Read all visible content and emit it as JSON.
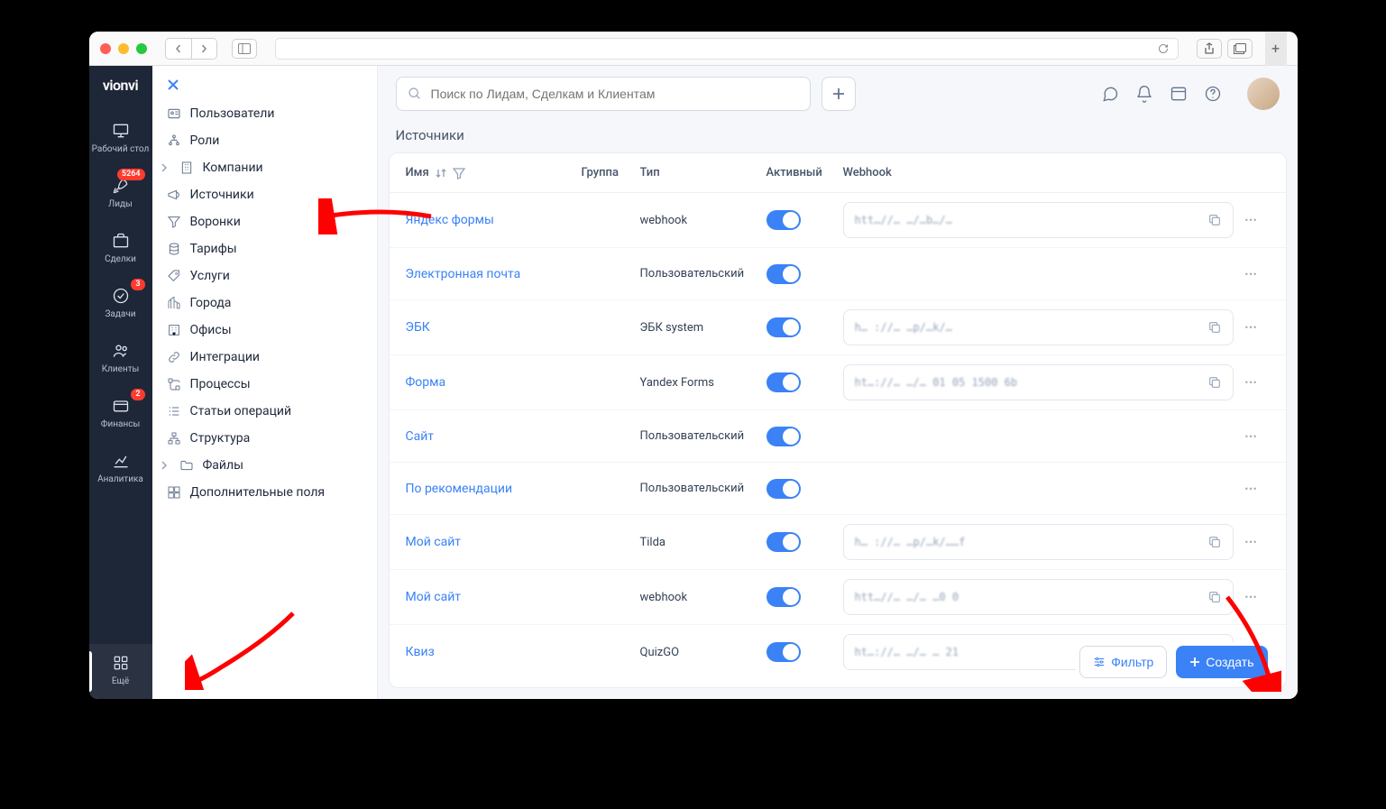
{
  "brand": "vionvi",
  "rail": [
    {
      "label": "Рабочий стол"
    },
    {
      "label": "Лиды",
      "badge": "5264"
    },
    {
      "label": "Сделки"
    },
    {
      "label": "Задачи",
      "badge": "3"
    },
    {
      "label": "Клиенты"
    },
    {
      "label": "Финансы",
      "badge": "2"
    },
    {
      "label": "Аналитика"
    },
    {
      "label": "Ещё"
    }
  ],
  "sidepanel": [
    {
      "label": "Пользователи"
    },
    {
      "label": "Роли"
    },
    {
      "label": "Компании",
      "chevron": true
    },
    {
      "label": "Источники"
    },
    {
      "label": "Воронки"
    },
    {
      "label": "Тарифы"
    },
    {
      "label": "Услуги"
    },
    {
      "label": "Города"
    },
    {
      "label": "Офисы"
    },
    {
      "label": "Интеграции"
    },
    {
      "label": "Процессы"
    },
    {
      "label": "Статьи операций"
    },
    {
      "label": "Структура"
    },
    {
      "label": "Файлы",
      "chevron": true
    },
    {
      "label": "Дополнительные поля"
    }
  ],
  "search_placeholder": "Поиск по Лидам, Сделкам и Клиентам",
  "page_title": "Источники",
  "columns": {
    "name": "Имя",
    "group": "Группа",
    "type": "Тип",
    "active": "Активный",
    "webhook": "Webhook"
  },
  "rows": [
    {
      "name": "Яндекс формы",
      "type": "webhook",
      "active": true,
      "webhook": "htt…//…      …/…b…/…"
    },
    {
      "name": "Электронная почта",
      "type": "Пользовательский",
      "active": true,
      "webhook": ""
    },
    {
      "name": "ЭБК",
      "type": "ЭБК system",
      "active": true,
      "webhook": "h…  ://… …p/…k/…"
    },
    {
      "name": "Форма",
      "type": "Yandex Forms",
      "active": true,
      "webhook": "ht…://… …/… 01 05 1500 6b"
    },
    {
      "name": "Сайт",
      "type": "Пользовательский",
      "active": true,
      "webhook": ""
    },
    {
      "name": "По рекомендации",
      "type": "Пользовательский",
      "active": true,
      "webhook": ""
    },
    {
      "name": "Мой сайт",
      "type": "Tilda",
      "active": true,
      "webhook": "h…  ://… …p/…k/……f"
    },
    {
      "name": "Мой сайт",
      "type": "webhook",
      "active": true,
      "webhook": "htt…//…   …/…   …0 0"
    },
    {
      "name": "Квиз",
      "type": "QuizGO",
      "active": true,
      "webhook": "ht…://… …/… … 21"
    }
  ],
  "buttons": {
    "filter": "Фильтр",
    "create": "Создать"
  }
}
